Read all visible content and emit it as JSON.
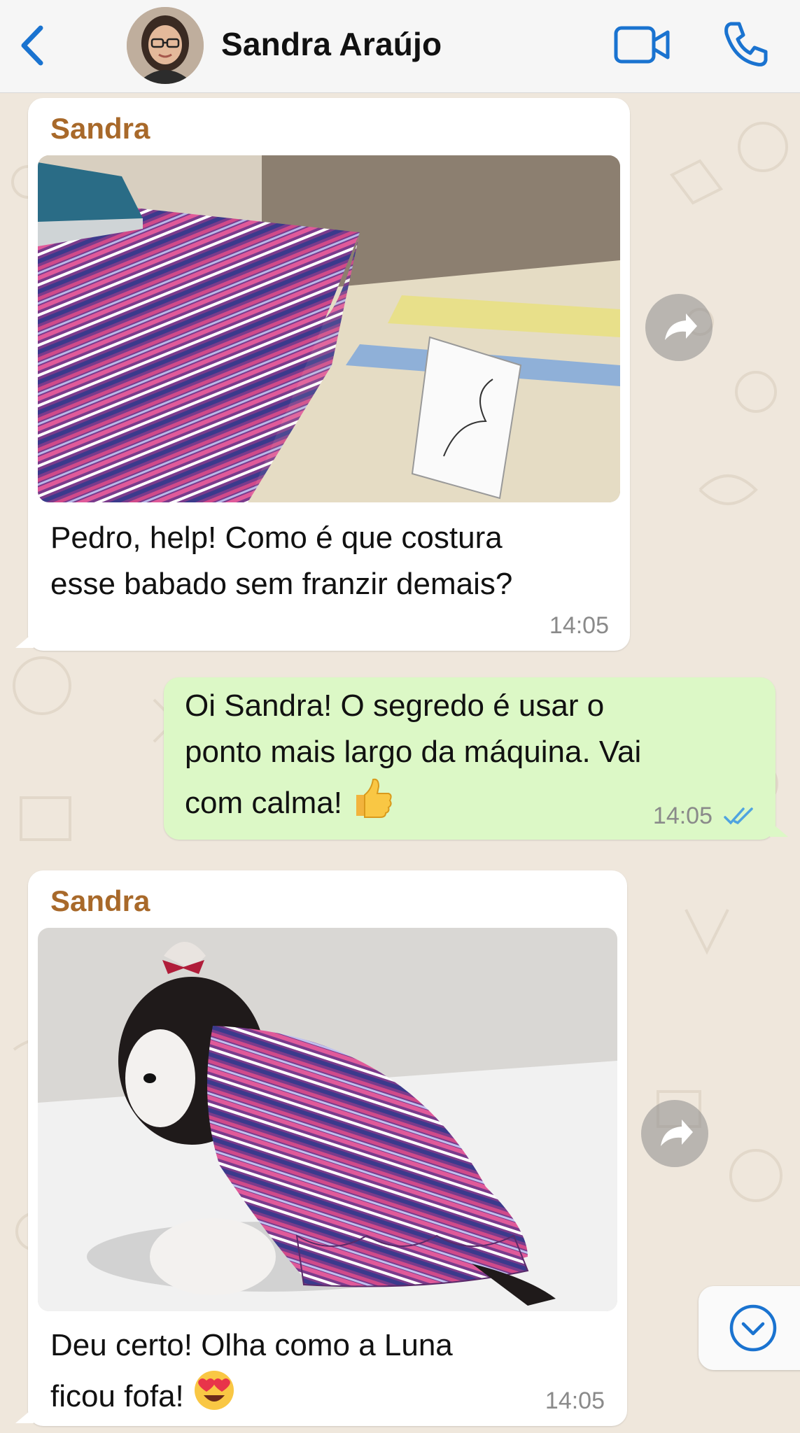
{
  "header": {
    "contact_name": "Sandra Araújo",
    "back_icon": "chevron-left-icon",
    "video_icon": "video-camera-icon",
    "call_icon": "phone-icon",
    "accent_color": "#1a73d0"
  },
  "messages": [
    {
      "direction": "incoming",
      "sender": "Sandra",
      "media": "photo-striped-fabric-on-ironing-board",
      "text_lines": [
        "Pedro, help! Como é que costura",
        "esse babado sem franzir demais?"
      ],
      "time": "14:05"
    },
    {
      "direction": "outgoing",
      "text_lines": [
        "Oi Sandra! O segredo é usar o",
        "ponto mais largo da máquina. Vai",
        "com calma!"
      ],
      "emoji": "thumbs-up",
      "time": "14:05",
      "status": "read"
    },
    {
      "direction": "incoming",
      "sender": "Sandra",
      "media": "photo-dog-in-striped-dress",
      "text_lines": [
        "Deu certo! Olha como a Luna",
        "ficou fofa!"
      ],
      "emoji": "heart-eyes",
      "time": "14:05"
    }
  ],
  "controls": {
    "forward_icon": "share-arrow-icon",
    "scroll_down_icon": "chevron-down-circle-icon"
  },
  "colors": {
    "wallpaper": "#efe7dc",
    "incoming_bubble": "#ffffff",
    "outgoing_bubble": "#dcf8c6",
    "sender_name": "#a8692a",
    "read_ticks": "#4fa3e0"
  }
}
